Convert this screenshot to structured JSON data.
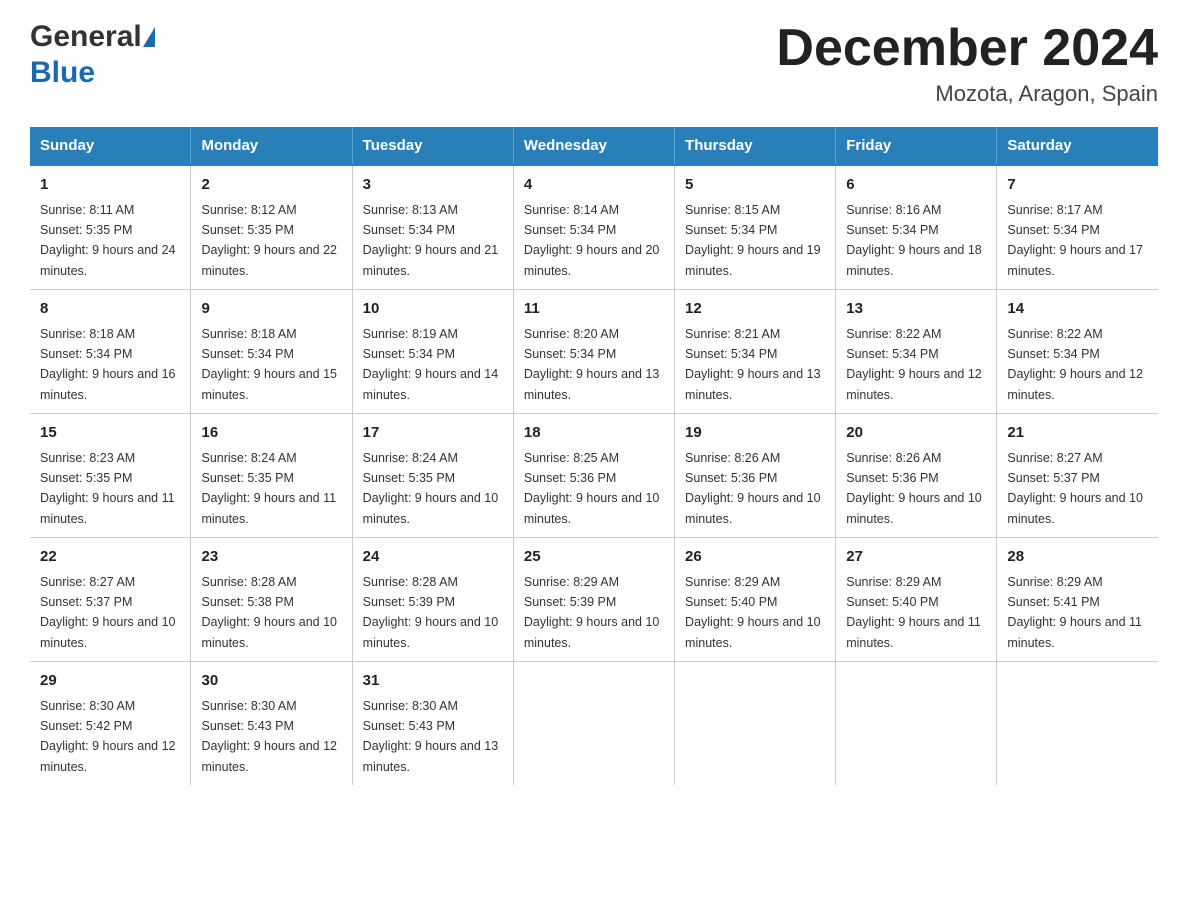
{
  "header": {
    "logo_general": "General",
    "logo_blue": "Blue",
    "month_title": "December 2024",
    "location": "Mozota, Aragon, Spain"
  },
  "calendar": {
    "days_of_week": [
      "Sunday",
      "Monday",
      "Tuesday",
      "Wednesday",
      "Thursday",
      "Friday",
      "Saturday"
    ],
    "weeks": [
      [
        {
          "day": "1",
          "sunrise": "8:11 AM",
          "sunset": "5:35 PM",
          "daylight": "9 hours and 24 minutes."
        },
        {
          "day": "2",
          "sunrise": "8:12 AM",
          "sunset": "5:35 PM",
          "daylight": "9 hours and 22 minutes."
        },
        {
          "day": "3",
          "sunrise": "8:13 AM",
          "sunset": "5:34 PM",
          "daylight": "9 hours and 21 minutes."
        },
        {
          "day": "4",
          "sunrise": "8:14 AM",
          "sunset": "5:34 PM",
          "daylight": "9 hours and 20 minutes."
        },
        {
          "day": "5",
          "sunrise": "8:15 AM",
          "sunset": "5:34 PM",
          "daylight": "9 hours and 19 minutes."
        },
        {
          "day": "6",
          "sunrise": "8:16 AM",
          "sunset": "5:34 PM",
          "daylight": "9 hours and 18 minutes."
        },
        {
          "day": "7",
          "sunrise": "8:17 AM",
          "sunset": "5:34 PM",
          "daylight": "9 hours and 17 minutes."
        }
      ],
      [
        {
          "day": "8",
          "sunrise": "8:18 AM",
          "sunset": "5:34 PM",
          "daylight": "9 hours and 16 minutes."
        },
        {
          "day": "9",
          "sunrise": "8:18 AM",
          "sunset": "5:34 PM",
          "daylight": "9 hours and 15 minutes."
        },
        {
          "day": "10",
          "sunrise": "8:19 AM",
          "sunset": "5:34 PM",
          "daylight": "9 hours and 14 minutes."
        },
        {
          "day": "11",
          "sunrise": "8:20 AM",
          "sunset": "5:34 PM",
          "daylight": "9 hours and 13 minutes."
        },
        {
          "day": "12",
          "sunrise": "8:21 AM",
          "sunset": "5:34 PM",
          "daylight": "9 hours and 13 minutes."
        },
        {
          "day": "13",
          "sunrise": "8:22 AM",
          "sunset": "5:34 PM",
          "daylight": "9 hours and 12 minutes."
        },
        {
          "day": "14",
          "sunrise": "8:22 AM",
          "sunset": "5:34 PM",
          "daylight": "9 hours and 12 minutes."
        }
      ],
      [
        {
          "day": "15",
          "sunrise": "8:23 AM",
          "sunset": "5:35 PM",
          "daylight": "9 hours and 11 minutes."
        },
        {
          "day": "16",
          "sunrise": "8:24 AM",
          "sunset": "5:35 PM",
          "daylight": "9 hours and 11 minutes."
        },
        {
          "day": "17",
          "sunrise": "8:24 AM",
          "sunset": "5:35 PM",
          "daylight": "9 hours and 10 minutes."
        },
        {
          "day": "18",
          "sunrise": "8:25 AM",
          "sunset": "5:36 PM",
          "daylight": "9 hours and 10 minutes."
        },
        {
          "day": "19",
          "sunrise": "8:26 AM",
          "sunset": "5:36 PM",
          "daylight": "9 hours and 10 minutes."
        },
        {
          "day": "20",
          "sunrise": "8:26 AM",
          "sunset": "5:36 PM",
          "daylight": "9 hours and 10 minutes."
        },
        {
          "day": "21",
          "sunrise": "8:27 AM",
          "sunset": "5:37 PM",
          "daylight": "9 hours and 10 minutes."
        }
      ],
      [
        {
          "day": "22",
          "sunrise": "8:27 AM",
          "sunset": "5:37 PM",
          "daylight": "9 hours and 10 minutes."
        },
        {
          "day": "23",
          "sunrise": "8:28 AM",
          "sunset": "5:38 PM",
          "daylight": "9 hours and 10 minutes."
        },
        {
          "day": "24",
          "sunrise": "8:28 AM",
          "sunset": "5:39 PM",
          "daylight": "9 hours and 10 minutes."
        },
        {
          "day": "25",
          "sunrise": "8:29 AM",
          "sunset": "5:39 PM",
          "daylight": "9 hours and 10 minutes."
        },
        {
          "day": "26",
          "sunrise": "8:29 AM",
          "sunset": "5:40 PM",
          "daylight": "9 hours and 10 minutes."
        },
        {
          "day": "27",
          "sunrise": "8:29 AM",
          "sunset": "5:40 PM",
          "daylight": "9 hours and 11 minutes."
        },
        {
          "day": "28",
          "sunrise": "8:29 AM",
          "sunset": "5:41 PM",
          "daylight": "9 hours and 11 minutes."
        }
      ],
      [
        {
          "day": "29",
          "sunrise": "8:30 AM",
          "sunset": "5:42 PM",
          "daylight": "9 hours and 12 minutes."
        },
        {
          "day": "30",
          "sunrise": "8:30 AM",
          "sunset": "5:43 PM",
          "daylight": "9 hours and 12 minutes."
        },
        {
          "day": "31",
          "sunrise": "8:30 AM",
          "sunset": "5:43 PM",
          "daylight": "9 hours and 13 minutes."
        },
        null,
        null,
        null,
        null
      ]
    ]
  }
}
